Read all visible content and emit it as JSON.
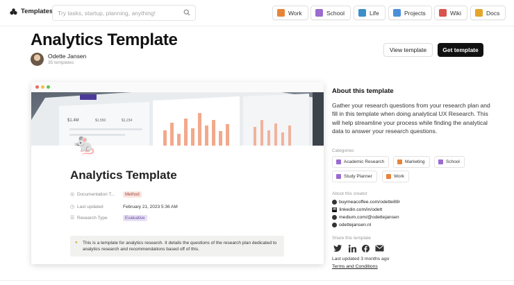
{
  "topbar": {
    "brand_label": "Templates",
    "search_placeholder": "Try tasks, startup, planning, anything!",
    "pills": [
      {
        "label": "Work",
        "color": "#e8843a"
      },
      {
        "label": "School",
        "color": "#9b6bd0"
      },
      {
        "label": "Life",
        "color": "#3c8fc7"
      },
      {
        "label": "Projects",
        "color": "#4a90d9"
      },
      {
        "label": "Wiki",
        "color": "#d9534f"
      },
      {
        "label": "Docs",
        "color": "#e3a52b"
      }
    ]
  },
  "header": {
    "title": "Analytics Template",
    "author_name": "Odette Jansen",
    "author_count": "35 templates",
    "view_button": "View template",
    "get_button": "Get template"
  },
  "preview": {
    "cover_figures": [
      "$1.4M",
      "$1,550",
      "$1,234"
    ],
    "title": "Analytics Template",
    "properties": [
      {
        "key": "Documentation T...",
        "value": "Method",
        "tag_color": "#fbe4e0",
        "tag_text": "#a04a3c"
      },
      {
        "key": "Last updated",
        "value": "February 21, 2023 5:36 AM"
      },
      {
        "key": "Research Type",
        "value": "Evaluative",
        "tag_color": "#e8e0f5",
        "tag_text": "#6b4fa0"
      }
    ],
    "callout_text": "This is a template for analytics research. It details the questions of the research plan dedicated to analytics research and recommendations based off of this."
  },
  "about": {
    "heading": "About this template",
    "description": "Gather your research questions from your research plan and fill in this template when doing analytical UX Research. This will help streamline your process while finding the analytical data to answer your research questions.",
    "categories_label": "Categories",
    "categories": [
      {
        "label": "Academic Research",
        "color": "#9b6bd0"
      },
      {
        "label": "Marketing",
        "color": "#e8843a"
      },
      {
        "label": "School",
        "color": "#9b6bd0"
      },
      {
        "label": "Study Planner",
        "color": "#9b6bd0"
      },
      {
        "label": "Work",
        "color": "#e8843a"
      }
    ],
    "creator_label": "About this creator",
    "links": [
      {
        "icon": "globe-icon",
        "text": "buymeacoffee.com/odette89r"
      },
      {
        "icon": "linkedin-icon",
        "text": "linkedin.com/in/odett"
      },
      {
        "icon": "globe-icon",
        "text": "medium.com/@odettejansen"
      },
      {
        "icon": "globe-icon",
        "text": "odettejansen.nl"
      }
    ],
    "share_label": "Share this template",
    "last_updated": "Last updated 3 months ago",
    "terms": "Terms and Conditions"
  }
}
